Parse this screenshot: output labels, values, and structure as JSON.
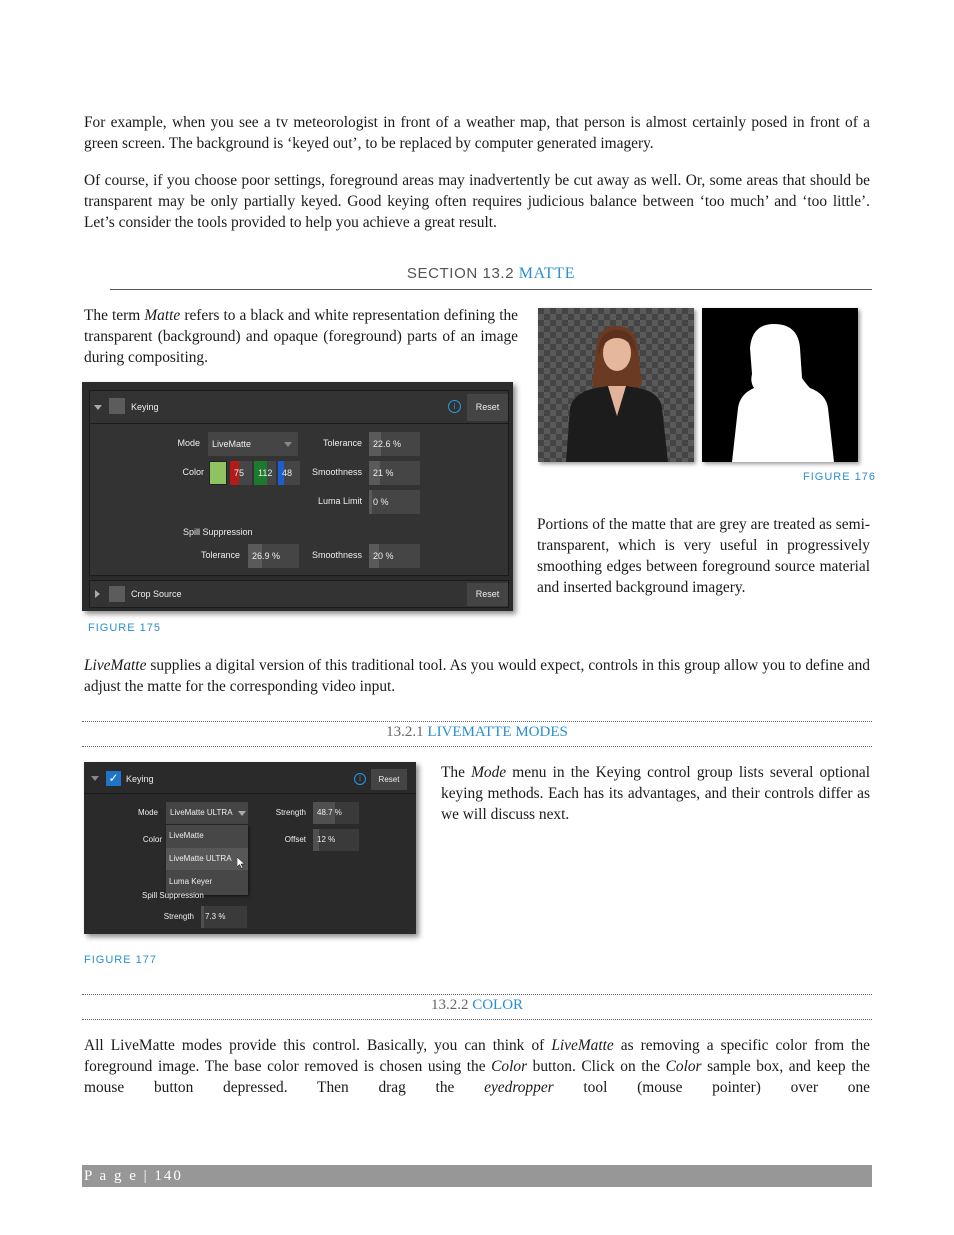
{
  "intro": {
    "p1": "For example, when you see a tv meteorologist in front of a weather map, that person is almost certainly posed in front of a green screen.  The background is ‘keyed out’, to be replaced by computer generated imagery.",
    "p2": "Of course, if you choose poor settings, foreground areas may inadvertently be cut away as well. Or, some areas that should be transparent may be only partially keyed.  Good keying often requires judicious balance between ‘too much’ and ‘too little’.  Let’s consider the tools provided to help you achieve a great result."
  },
  "section": {
    "number": "SECTION 13.2",
    "title": "MATTE"
  },
  "matte": {
    "p1_a": "The term ",
    "p1_em": "Matte",
    "p1_b": " refers to a black and white representation defining the transparent (background) and opaque (foreground) parts of an image during compositing.",
    "p2": "Portions of the matte that are grey are treated as semi-transparent, which is very useful in progressively smoothing edges between foreground source material and inserted background imagery.",
    "p3_em": "LiveMatte",
    "p3_b": " supplies a digital version of this traditional tool.  As you would expect, controls in this group allow you to define and adjust the matte for the corresponding video input."
  },
  "figure175": {
    "caption": "FIGURE 175",
    "keying": {
      "title": "Keying",
      "reset": "Reset",
      "info_icon": "i",
      "mode_label": "Mode",
      "mode_value": "LiveMatte",
      "color_label": "Color",
      "swatch_color": "#8fc361",
      "r": "75",
      "g": "112",
      "b": "48",
      "tolerance_label": "Tolerance",
      "tolerance_value": "22.6 %",
      "tolerance_frac": 0.226,
      "smoothness_label": "Smoothness",
      "smoothness_value": "21 %",
      "smoothness_frac": 0.21,
      "luma_label": "Luma Limit",
      "luma_value": "0 %",
      "luma_frac": 0.0,
      "spill_label": "Spill Suppression",
      "spill_tol_label": "Tolerance",
      "spill_tol_value": "26.9 %",
      "spill_tol_frac": 0.269,
      "spill_smooth_label": "Smoothness",
      "spill_smooth_value": "20 %",
      "spill_smooth_frac": 0.2
    },
    "crop": {
      "title": "Crop Source",
      "reset": "Reset"
    }
  },
  "figure176": {
    "caption": "FIGURE 176"
  },
  "sub1": {
    "number": "13.2.1",
    "title": "LIVEMATTE MODES"
  },
  "modes": {
    "p_a": "The ",
    "p_em": "Mode",
    "p_b": " menu in the Keying control group lists several optional keying methods.  Each has its advantages, and their controls differ as we will discuss next."
  },
  "figure177": {
    "caption": "FIGURE 177",
    "title": "Keying",
    "reset": "Reset",
    "mode_label": "Mode",
    "mode_value": "LiveMatte ULTRA",
    "color_label": "Color",
    "options": [
      "LiveMatte",
      "LiveMatte ULTRA",
      "Luma Keyer"
    ],
    "strength_label": "Strength",
    "strength_value": "48.7 %",
    "strength_frac": 0.487,
    "offset_label": "Offset",
    "offset_value": "12 %",
    "offset_frac": 0.12,
    "spill_label": "Spill Suppression",
    "spill_strength_label": "Strength",
    "spill_strength_value": "7.3 %",
    "spill_strength_frac": 0.073
  },
  "sub2": {
    "number": "13.2.2",
    "title": "COLOR"
  },
  "color": {
    "s1": "All LiveMatte modes provide this control.  Basically, you can think of ",
    "e1": "LiveMatte",
    "s2": " as removing a specific color from the foreground image. The base color removed is chosen using the ",
    "e2": "Color",
    "s3": " button. Click on the ",
    "e3": "Color",
    "s4": " sample box, and keep the mouse button depressed.  Then drag the ",
    "e4": "eyedropper",
    "s5": " tool (mouse pointer) over one"
  },
  "footer": {
    "label": "P a g e",
    "page": "140"
  }
}
